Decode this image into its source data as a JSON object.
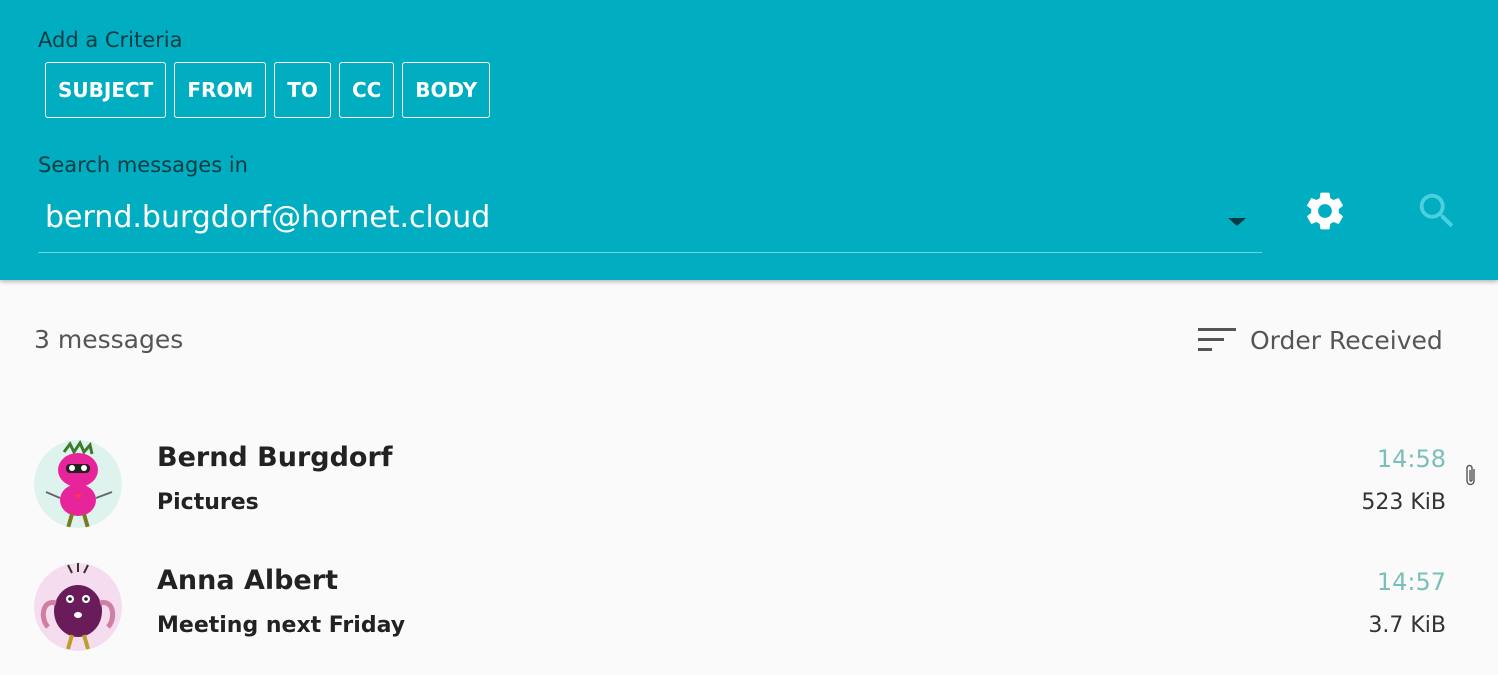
{
  "search_panel": {
    "criteria_label": "Add a Criteria",
    "criteria_chips": [
      "SUBJECT",
      "FROM",
      "TO",
      "CC",
      "BODY"
    ],
    "search_in_label": "Search messages in",
    "search_in_value": "bernd.burgdorf@hornet.cloud",
    "icons": {
      "settings": "gear-icon",
      "search": "search-icon",
      "dropdown": "chevron-down-icon"
    }
  },
  "list": {
    "count_label": "3 messages",
    "sort_label": "Order Received",
    "sort_icon": "sort-icon",
    "messages": [
      {
        "sender": "Bernd Burgdorf",
        "subject": "Pictures",
        "time": "14:58",
        "size": "523 KiB",
        "attachment": true,
        "avatar": "pink-monster-avatar"
      },
      {
        "sender": "Anna Albert",
        "subject": "Meeting next Friday",
        "time": "14:57",
        "size": "3.7 KiB",
        "attachment": false,
        "avatar": "purple-monster-avatar"
      }
    ]
  },
  "colors": {
    "header_bg": "#00adc1",
    "time_text": "#7bbfb9",
    "page_bg": "#fafafa"
  }
}
